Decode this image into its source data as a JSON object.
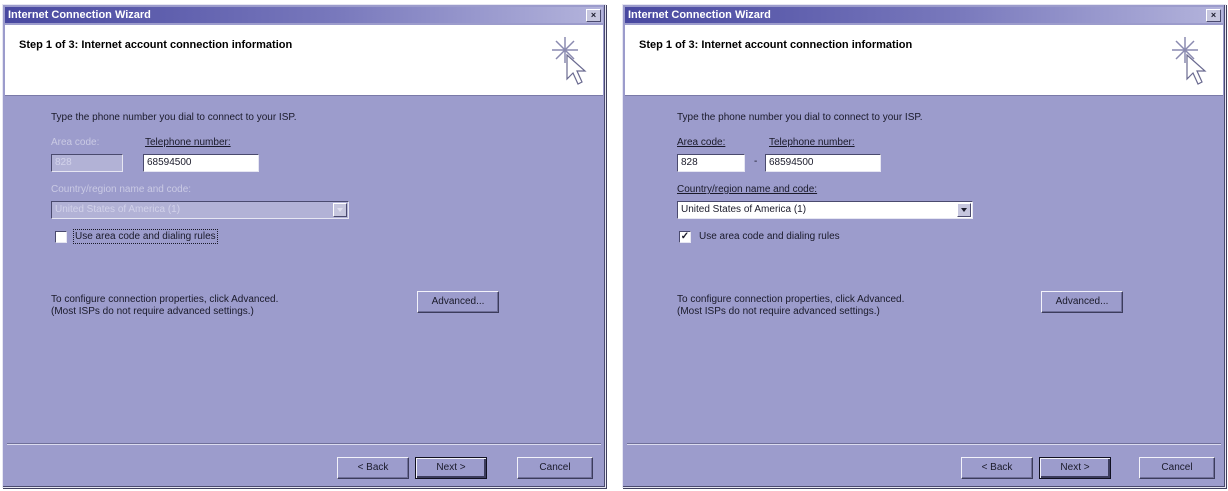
{
  "dialogs": [
    {
      "title": "Internet Connection Wizard",
      "step_title": "Step 1 of 3: Internet account connection information",
      "prompt": "Type the phone number you dial to connect to your ISP.",
      "area_code_label": "Area code:",
      "area_code_value": "828",
      "area_separator": "",
      "phone_label": "Telephone number:",
      "phone_value": "68594500",
      "country_label": "Country/region name and code:",
      "country_value": "United States of America (1)",
      "checkbox_label": "Use area code and dialing rules",
      "checkbox_checked": false,
      "checkbox_mark": "",
      "configure_text_1": "To configure connection properties, click Advanced.",
      "configure_text_2": "(Most ISPs do not require advanced settings.)",
      "advanced_label": "Advanced...",
      "back_label": "< Back",
      "next_label": "Next >",
      "cancel_label": "Cancel"
    },
    {
      "title": "Internet Connection Wizard",
      "step_title": "Step 1 of 3: Internet account connection information",
      "prompt": "Type the phone number you dial to connect to your ISP.",
      "area_code_label": "Area code:",
      "area_code_value": "828",
      "area_separator": "-",
      "phone_label": "Telephone number:",
      "phone_value": "68594500",
      "country_label": "Country/region name and code:",
      "country_value": "United States of America (1)",
      "checkbox_label": "Use area code and dialing rules",
      "checkbox_checked": true,
      "checkbox_mark": "✓",
      "configure_text_1": "To configure connection properties, click Advanced.",
      "configure_text_2": "(Most ISPs do not require advanced settings.)",
      "advanced_label": "Advanced...",
      "back_label": "< Back",
      "next_label": "Next >",
      "cancel_label": "Cancel"
    }
  ],
  "icons": {
    "close": "×",
    "wizard": "wizard-sparkle-cursor-icon"
  },
  "colors": {
    "dialog_bg": "#9c9ccc",
    "title_gradient_start": "#4848a0",
    "header_bg": "#ffffff"
  }
}
